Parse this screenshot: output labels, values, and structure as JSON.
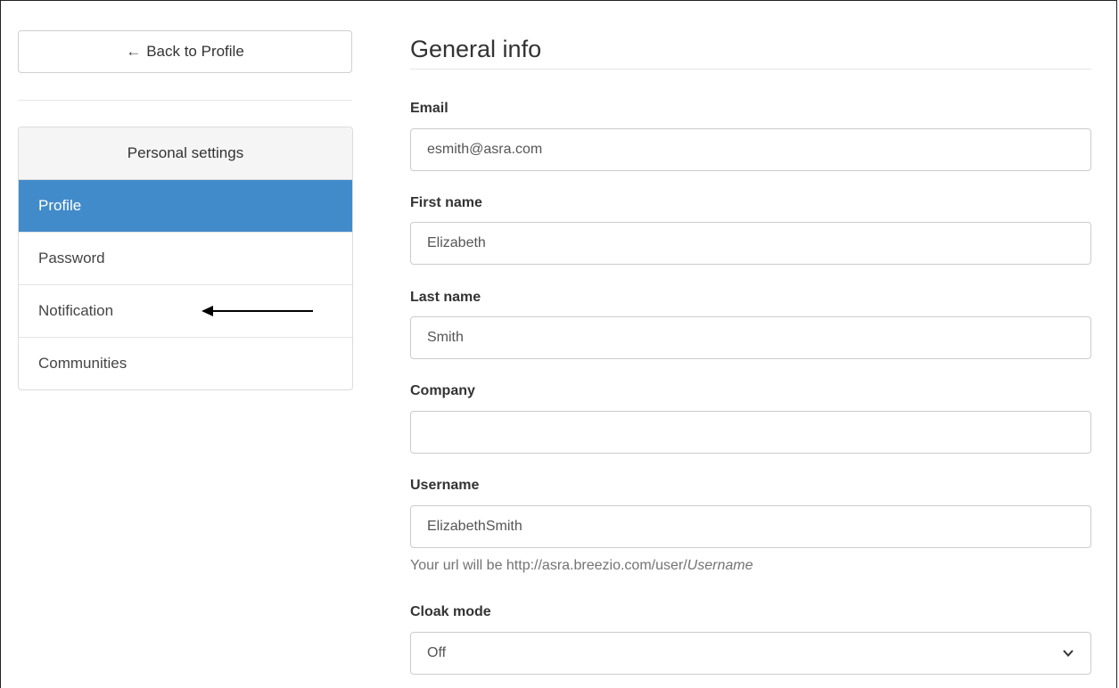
{
  "sidebar": {
    "back_button": {
      "arrow": "←",
      "label": "Back to Profile"
    },
    "panel_heading": "Personal settings",
    "items": [
      {
        "label": "Profile",
        "active": true
      },
      {
        "label": "Password",
        "active": false
      },
      {
        "label": "Notification",
        "active": false
      },
      {
        "label": "Communities",
        "active": false
      }
    ],
    "annotation_arrow_icon": "left-arrow-icon"
  },
  "main": {
    "title": "General info",
    "email": {
      "label": "Email",
      "value": "esmith@asra.com"
    },
    "first_name": {
      "label": "First name",
      "value": "Elizabeth"
    },
    "last_name": {
      "label": "Last name",
      "value": "Smith"
    },
    "company": {
      "label": "Company",
      "value": ""
    },
    "username": {
      "label": "Username",
      "value": "ElizabethSmith"
    },
    "username_help": {
      "prefix": "Your url will be http://asra.breezio.com/user/",
      "suffix": "Username"
    },
    "cloak_mode": {
      "label": "Cloak mode",
      "selected": "Off"
    }
  },
  "colors": {
    "active_item_bg": "#428bca",
    "active_item_text": "#ffffff"
  }
}
